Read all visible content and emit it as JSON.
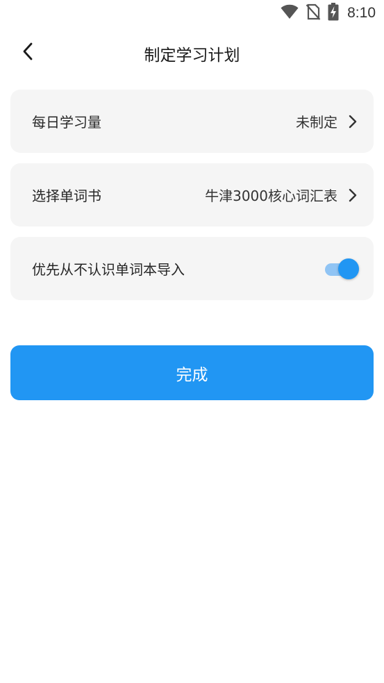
{
  "status_bar": {
    "time": "8:10",
    "icons": [
      "wifi-icon",
      "no-sim-icon",
      "battery-charging-icon"
    ]
  },
  "header": {
    "title": "制定学习计划",
    "back_icon": "chevron-left-icon"
  },
  "settings": {
    "daily_amount": {
      "label": "每日学习量",
      "value": "未制定"
    },
    "word_book": {
      "label": "选择单词书",
      "value": "牛津3000核心词汇表"
    },
    "import_unknown": {
      "label": "优先从不认识单词本导入",
      "enabled": true
    }
  },
  "done_button": {
    "label": "完成"
  },
  "colors": {
    "accent": "#2196f3",
    "card_background": "#f5f5f5",
    "toggle_track": "#90c4f4"
  }
}
